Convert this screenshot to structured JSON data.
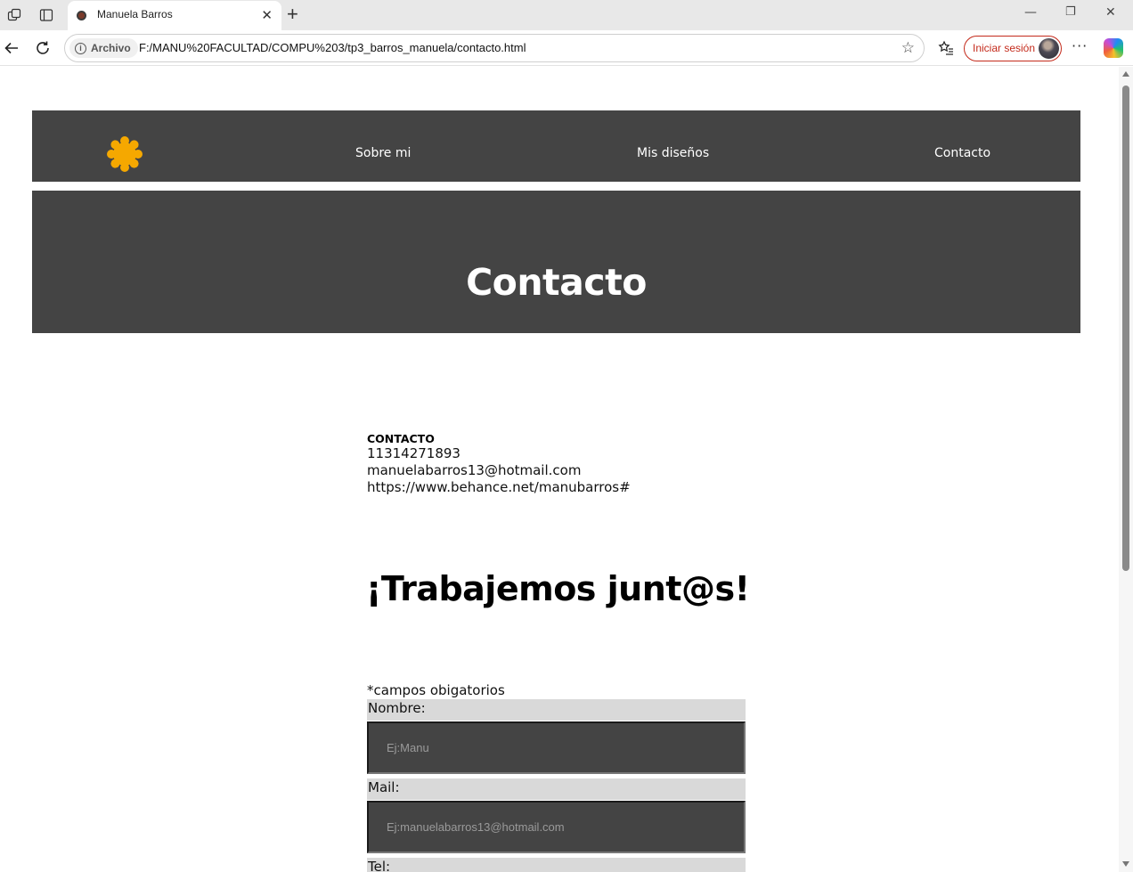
{
  "browser": {
    "tab_title": "Manuela Barros",
    "chip_label": "Archivo",
    "url": "F:/MANU%20FACULTAD/COMPU%203/tp3_barros_manuela/contacto.html",
    "signin_label": "Iniciar sesión"
  },
  "nav": {
    "logo_color": "#F5A800",
    "links": [
      "Sobre mi",
      "Mis diseños",
      "Contacto"
    ]
  },
  "hero": {
    "title": "Contacto"
  },
  "contact": {
    "heading": "CONTACTO",
    "phone": "11314271893",
    "email": "manuelabarros13@hotmail.com",
    "website": "https://www.behance.net/manubarros#"
  },
  "cta": {
    "title": "¡Trabajemos junt@s!"
  },
  "form": {
    "required_note": "*campos obigatorios",
    "fields": [
      {
        "label": "Nombre:",
        "placeholder": "Ej:Manu"
      },
      {
        "label": "Mail:",
        "placeholder": "Ej:manuelabarros13@hotmail.com"
      },
      {
        "label": "Tel:"
      }
    ]
  },
  "colors": {
    "dark_panel": "#444444",
    "label_bg": "#d9d9d9",
    "signin_accent": "#c42b1c"
  }
}
